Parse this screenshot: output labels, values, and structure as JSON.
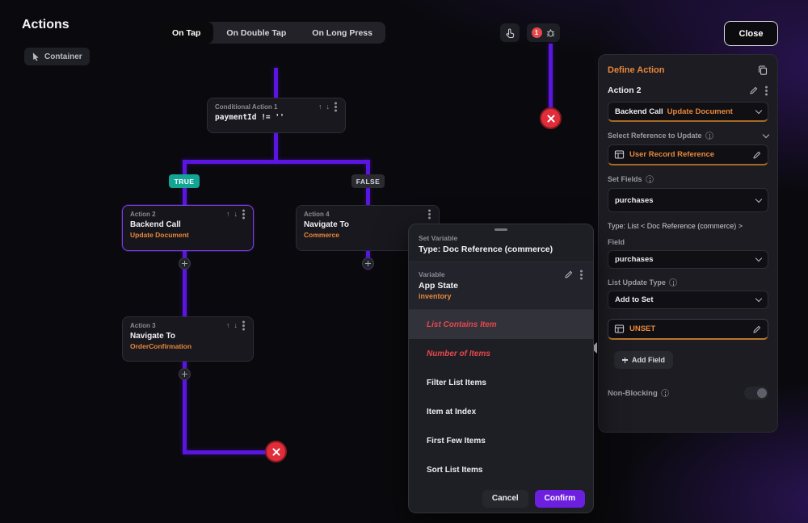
{
  "header": {
    "title": "Actions",
    "selected_element": "Container",
    "tabs": {
      "on_tap": "On Tap",
      "on_double_tap": "On Double Tap",
      "on_long_press": "On Long Press"
    },
    "error_badge_count": "1",
    "close_label": "Close"
  },
  "icons": {
    "arrow_up": "↑",
    "arrow_down": "↓"
  },
  "canvas": {
    "conditional_node": {
      "title": "Conditional Action 1",
      "expression": "paymentId != ''"
    },
    "true_badge": "TRUE",
    "false_badge": "FALSE",
    "action2_node": {
      "title": "Action 2",
      "type": "Backend Call",
      "detail": "Update Document"
    },
    "action4_node": {
      "title": "Action 4",
      "type": "Navigate To",
      "detail": "Commerce"
    },
    "action3_node": {
      "title": "Action 3",
      "type": "Navigate To",
      "detail": "OrderConfirmation"
    }
  },
  "popup": {
    "kicker": "Set Variable",
    "title": "Type: Doc Reference (commerce)",
    "variable": {
      "label": "Variable",
      "scope": "App State",
      "name": "inventory"
    },
    "options": [
      {
        "label": "List Contains Item"
      },
      {
        "label": "Number of Items"
      },
      {
        "label": "Filter List Items"
      },
      {
        "label": "Item at Index"
      },
      {
        "label": "First Few Items"
      },
      {
        "label": "Sort List Items"
      }
    ],
    "cancel_label": "Cancel",
    "confirm_label": "Confirm"
  },
  "panel": {
    "title": "Define Action",
    "action_name": "Action 2",
    "action_type": "Backend Call",
    "action_detail": "Update Document",
    "reference_label": "Select Reference to Update",
    "reference_value": "User Record Reference",
    "set_fields_label": "Set Fields",
    "fields_dropdown_value": "purchases",
    "type_info": "Type: List < Doc Reference (commerce) >",
    "field_label": "Field",
    "field_value": "purchases",
    "list_update_label": "List Update Type",
    "list_update_value": "Add to Set",
    "unset_value": "UNSET",
    "add_field_label": "Add Field",
    "non_blocking_label": "Non-Blocking"
  },
  "colors": {
    "accent_orange": "#e8883a",
    "connector_purple": "#5a16e0",
    "selected_border_purple": "#7c3aed",
    "error_red": "#e5484d",
    "true_badge_teal": "#12a594",
    "confirm_button_purple": "#6d1fe0"
  }
}
